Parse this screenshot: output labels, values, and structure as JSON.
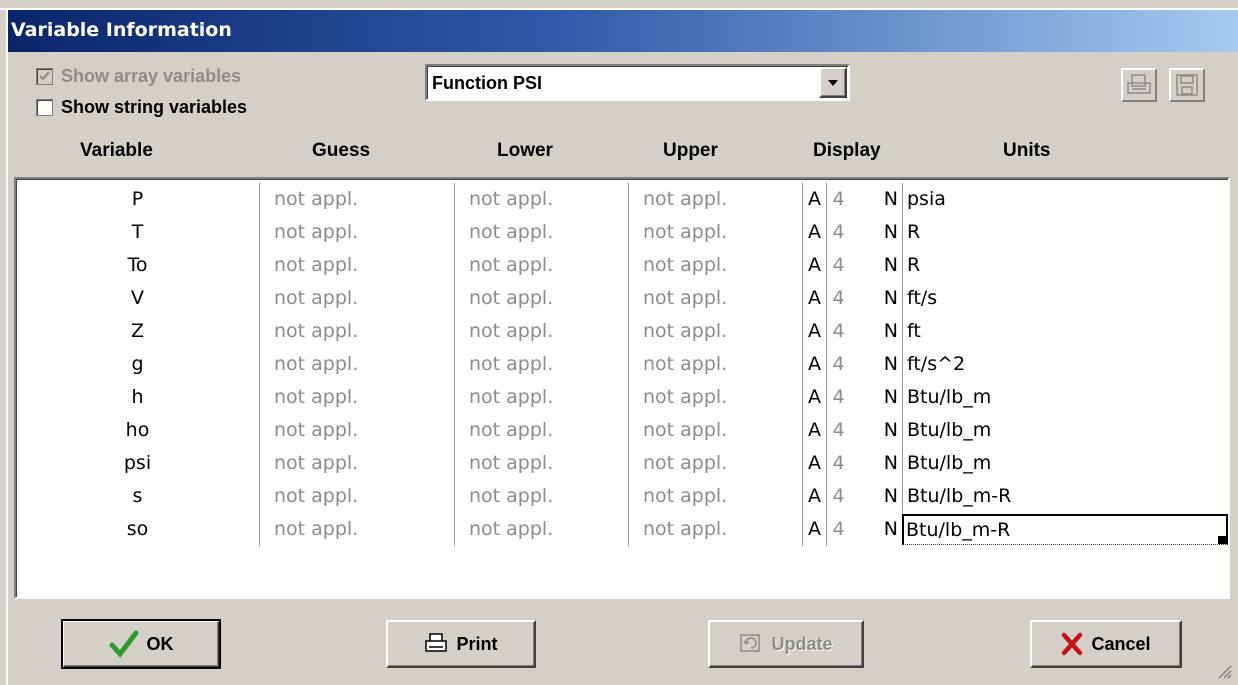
{
  "window": {
    "title": "Variable Information"
  },
  "options": {
    "show_array": {
      "label": "Show array variables",
      "checked": true,
      "disabled": true
    },
    "show_string": {
      "label": "Show string variables",
      "checked": false
    }
  },
  "function_select": {
    "value": "Function PSI"
  },
  "toolbar": {
    "print_icon": "print-preview-icon",
    "save_icon": "floppy-disk-icon"
  },
  "columns": {
    "variable": "Variable",
    "guess": "Guess",
    "lower": "Lower",
    "upper": "Upper",
    "display": "Display",
    "units": "Units"
  },
  "rows": [
    {
      "variable": "P",
      "guess": "not appl.",
      "lower": "not appl.",
      "upper": "not appl.",
      "fmt": "A",
      "digits": "4",
      "type": "N",
      "units": "psia"
    },
    {
      "variable": "T",
      "guess": "not appl.",
      "lower": "not appl.",
      "upper": "not appl.",
      "fmt": "A",
      "digits": "4",
      "type": "N",
      "units": "R"
    },
    {
      "variable": "To",
      "guess": "not appl.",
      "lower": "not appl.",
      "upper": "not appl.",
      "fmt": "A",
      "digits": "4",
      "type": "N",
      "units": "R"
    },
    {
      "variable": "V",
      "guess": "not appl.",
      "lower": "not appl.",
      "upper": "not appl.",
      "fmt": "A",
      "digits": "4",
      "type": "N",
      "units": "ft/s"
    },
    {
      "variable": "Z",
      "guess": "not appl.",
      "lower": "not appl.",
      "upper": "not appl.",
      "fmt": "A",
      "digits": "4",
      "type": "N",
      "units": "ft"
    },
    {
      "variable": "g",
      "guess": "not appl.",
      "lower": "not appl.",
      "upper": "not appl.",
      "fmt": "A",
      "digits": "4",
      "type": "N",
      "units": "ft/s^2"
    },
    {
      "variable": "h",
      "guess": "not appl.",
      "lower": "not appl.",
      "upper": "not appl.",
      "fmt": "A",
      "digits": "4",
      "type": "N",
      "units": "Btu/lb_m"
    },
    {
      "variable": "ho",
      "guess": "not appl.",
      "lower": "not appl.",
      "upper": "not appl.",
      "fmt": "A",
      "digits": "4",
      "type": "N",
      "units": "Btu/lb_m"
    },
    {
      "variable": "psi",
      "guess": "not appl.",
      "lower": "not appl.",
      "upper": "not appl.",
      "fmt": "A",
      "digits": "4",
      "type": "N",
      "units": "Btu/lb_m"
    },
    {
      "variable": "s",
      "guess": "not appl.",
      "lower": "not appl.",
      "upper": "not appl.",
      "fmt": "A",
      "digits": "4",
      "type": "N",
      "units": "Btu/lb_m-R"
    },
    {
      "variable": "so",
      "guess": "not appl.",
      "lower": "not appl.",
      "upper": "not appl.",
      "fmt": "A",
      "digits": "4",
      "type": "N",
      "units": "Btu/lb_m-R"
    }
  ],
  "buttons": {
    "ok": {
      "label": "OK",
      "icon": "checkmark-icon"
    },
    "print": {
      "label": "Print",
      "icon": "printer-icon"
    },
    "update": {
      "label": "Update",
      "icon": "update-icon",
      "disabled": true
    },
    "cancel": {
      "label": "Cancel",
      "icon": "red-x-icon"
    }
  },
  "colors": {
    "title_start": "#0a246a",
    "title_end": "#a6caf0",
    "ok_check": "#2e9a2e",
    "cancel_x": "#cc1111",
    "disabled_text": "#8c8c8c"
  }
}
